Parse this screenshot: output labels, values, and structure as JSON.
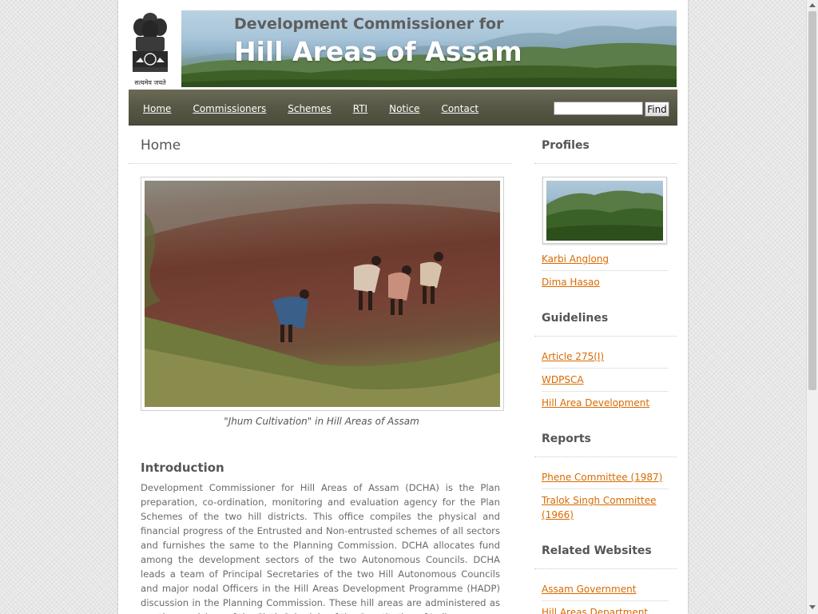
{
  "header": {
    "emblem_motto": "सत्यमेव जयते",
    "banner_line1": "Development Commissioner for",
    "banner_line2": "Hill Areas of Assam"
  },
  "nav": {
    "items": [
      {
        "label": "Home"
      },
      {
        "label": "Commissioners"
      },
      {
        "label": "Schemes"
      },
      {
        "label": "RTI"
      },
      {
        "label": "Notice"
      },
      {
        "label": "Contact"
      }
    ],
    "search_value": "",
    "find_label": "Find"
  },
  "main": {
    "title": "Home",
    "photo_caption": "\"Jhum Cultivation\" in Hill Areas of Assam",
    "intro_heading": "Introduction",
    "intro_text": "Development Commissioner for Hill Areas of Assam (DCHA) is the Plan preparation, co-ordination, monitoring and evaluation agency for the Plan Schemes of the two hill districts. This office compiles the physical and financial progress of the Entrusted and Non-entrusted schemes of all sectors and furnishes the same to the Planning Commission. DCHA allocates fund among the development sectors of the two Autonomous Councils. DCHA leads a team of Principal Secretaries of the two Hill Autonomous Councils and major nodal Officers in the Hill Areas Development Programme (HADP) discussion in the Planning Commission. These hill areas are administered as per the provisions of the Sixth Schedule of the Constitution of India..."
  },
  "sidebar": {
    "profiles": {
      "heading": "Profiles",
      "links": [
        "Karbi Anglong",
        "Dima Hasao"
      ]
    },
    "guidelines": {
      "heading": "Guidelines",
      "links": [
        "Article 275(I)",
        "WDPSCA",
        "Hill Area Development"
      ]
    },
    "reports": {
      "heading": "Reports",
      "links": [
        "Phene Committee (1987)",
        "Tralok Singh Committee (1966)"
      ]
    },
    "related": {
      "heading": "Related Websites",
      "links": [
        "Assam Government",
        "Hill Areas Department"
      ]
    }
  },
  "colors": {
    "link": "#d86a00",
    "nav_bar": "#575745",
    "heading_text": "#555555"
  }
}
